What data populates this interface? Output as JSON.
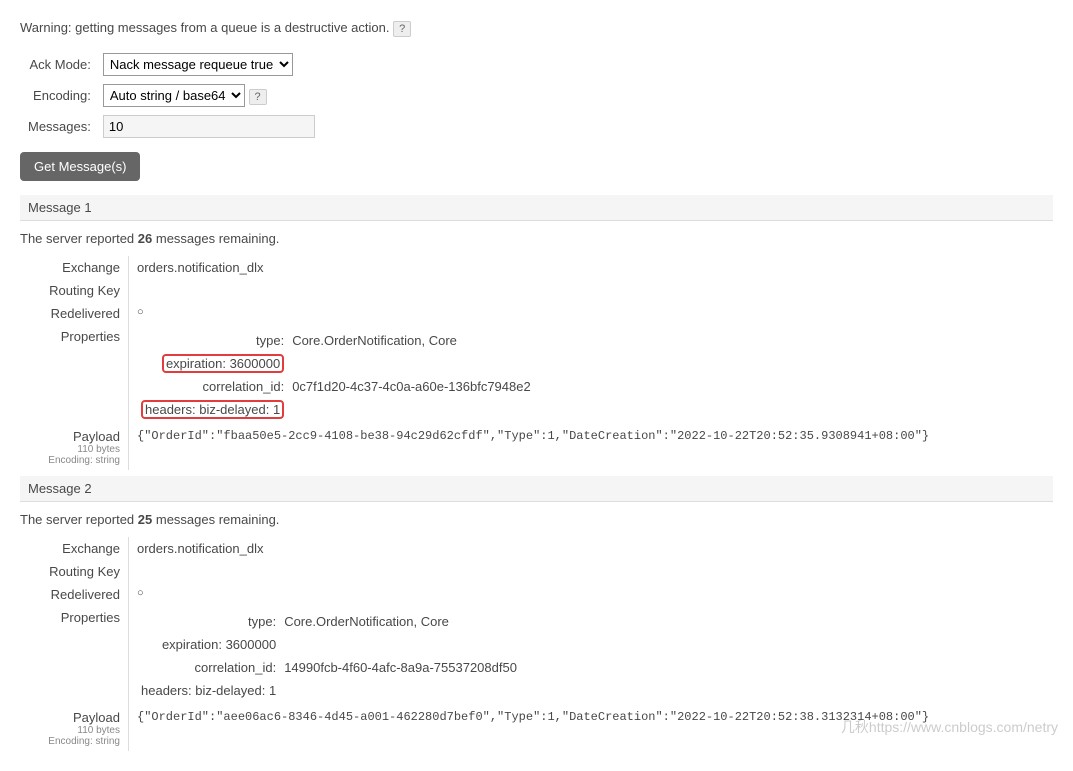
{
  "warning_text": "Warning: getting messages from a queue is a destructive action.",
  "help_icon": "?",
  "form": {
    "ack_mode_label": "Ack Mode:",
    "ack_mode_value": "Nack message requeue true",
    "encoding_label": "Encoding:",
    "encoding_value": "Auto string / base64",
    "messages_label": "Messages:",
    "messages_value": "10",
    "button_label": "Get Message(s)"
  },
  "messages": [
    {
      "header": "Message 1",
      "server_report_prefix": "The server reported ",
      "remaining_count": "26",
      "server_report_suffix": " messages remaining.",
      "exchange_label": "Exchange",
      "exchange_value": "orders.notification_dlx",
      "routing_key_label": "Routing Key",
      "routing_key_value": "",
      "redelivered_label": "Redelivered",
      "redelivered_value": "○",
      "properties_label": "Properties",
      "props": {
        "type_label": "type:",
        "type_value": "Core.OrderNotification, Core",
        "expiration_label": "expiration:",
        "expiration_value": "3600000",
        "correlation_id_label": "correlation_id:",
        "correlation_id_value": "0c7f1d20-4c37-4c0a-a60e-136bfc7948e2",
        "headers_label": "headers:",
        "headers_sub_label": "biz-delayed:",
        "headers_sub_value": "1"
      },
      "payload_label": "Payload",
      "payload_size": "110 bytes",
      "payload_encoding": "Encoding: string",
      "payload_value": "{\"OrderId\":\"fbaa50e5-2cc9-4108-be38-94c29d62cfdf\",\"Type\":1,\"DateCreation\":\"2022-10-22T20:52:35.9308941+08:00\"}",
      "highlighted": true
    },
    {
      "header": "Message 2",
      "server_report_prefix": "The server reported ",
      "remaining_count": "25",
      "server_report_suffix": " messages remaining.",
      "exchange_label": "Exchange",
      "exchange_value": "orders.notification_dlx",
      "routing_key_label": "Routing Key",
      "routing_key_value": "",
      "redelivered_label": "Redelivered",
      "redelivered_value": "○",
      "properties_label": "Properties",
      "props": {
        "type_label": "type:",
        "type_value": "Core.OrderNotification, Core",
        "expiration_label": "expiration:",
        "expiration_value": "3600000",
        "correlation_id_label": "correlation_id:",
        "correlation_id_value": "14990fcb-4f60-4afc-8a9a-75537208df50",
        "headers_label": "headers:",
        "headers_sub_label": "biz-delayed:",
        "headers_sub_value": "1"
      },
      "payload_label": "Payload",
      "payload_size": "110 bytes",
      "payload_encoding": "Encoding: string",
      "payload_value": "{\"OrderId\":\"aee06ac6-8346-4d45-a001-462280d7bef0\",\"Type\":1,\"DateCreation\":\"2022-10-22T20:52:38.3132314+08:00\"}",
      "highlighted": false
    }
  ],
  "watermark": "几秋https://www.cnblogs.com/netry"
}
